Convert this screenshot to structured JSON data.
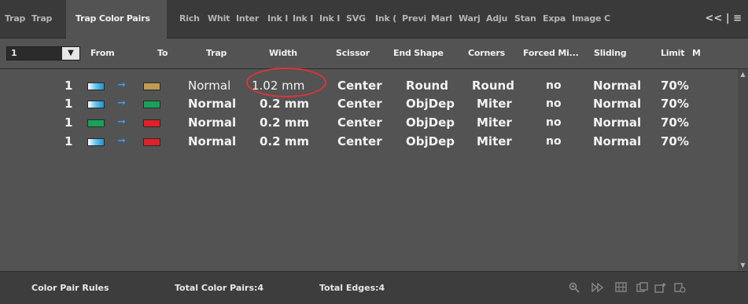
{
  "tabs": [
    "Trap",
    "Trap",
    "Trap Color Pairs",
    "Rich",
    "Whit",
    "Inter",
    "Ink I",
    "Ink I",
    "Ink I",
    "SVG",
    "Ink (",
    "Previ",
    "Marl",
    "Warj",
    "Adju",
    "Stan",
    "Expa",
    "Image C"
  ],
  "tab_controls": "<<  |  ≡",
  "active_tab_index": 2,
  "dropdown_value": "1",
  "columns": [
    "From",
    "To",
    "Trap",
    "Width",
    "Scissor",
    "End Shape",
    "Corners",
    "Forced Mi...",
    "Sliding",
    "Limit",
    "M"
  ],
  "rows": [
    {
      "index": "1",
      "from_color": "#4db8e8",
      "to_color": "#c09a55",
      "trap": "Normal",
      "width": "1.02 mm",
      "scissor": "Center",
      "end_shape": "Round",
      "corners": "Round",
      "forced": "no",
      "sliding": "Normal",
      "limit": "70%"
    },
    {
      "index": "1",
      "from_color": "#4db8e8",
      "to_color": "#1aa05a",
      "trap": "Normal",
      "width": "0.2 mm",
      "scissor": "Center",
      "end_shape": "ObjDep",
      "corners": "Miter",
      "forced": "no",
      "sliding": "Normal",
      "limit": "70%"
    },
    {
      "index": "1",
      "from_color": "#1aa05a",
      "to_color": "#e0202a",
      "trap": "Normal",
      "width": "0.2 mm",
      "scissor": "Center",
      "end_shape": "ObjDep",
      "corners": "Miter",
      "forced": "no",
      "sliding": "Normal",
      "limit": "70%"
    },
    {
      "index": "1",
      "from_color": "#4db8e8",
      "to_color": "#e0202a",
      "trap": "Normal",
      "width": "0.2 mm",
      "scissor": "Center",
      "end_shape": "ObjDep",
      "corners": "Miter",
      "forced": "no",
      "sliding": "Normal",
      "limit": "70%"
    }
  ],
  "footer": {
    "rules": "Color Pair Rules",
    "total_pairs": "Total Color Pairs:4",
    "total_edges": "Total Edges:4"
  },
  "footer_icons": [
    "zoom-icon",
    "play-forward-icon",
    "grid-icon",
    "duplicate-icon",
    "new-icon",
    "delete-icon"
  ],
  "highlight_color": "#e0333a"
}
